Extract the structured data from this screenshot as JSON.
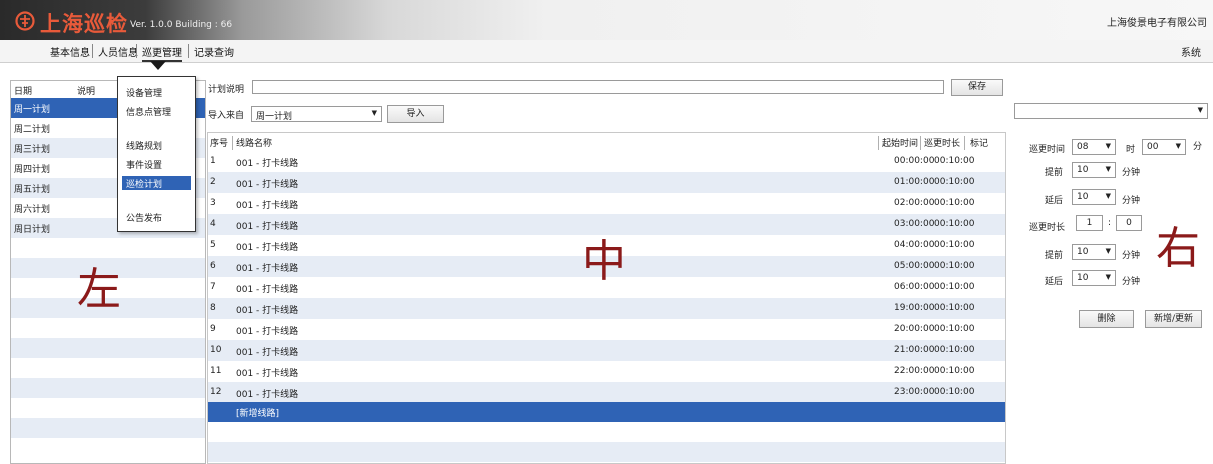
{
  "header": {
    "app_name": "上海巡检",
    "version": "Ver. 1.0.0 Building : 66",
    "company": "上海俊景电子有限公司"
  },
  "menu": {
    "items": [
      "基本信息",
      "人员信息",
      "巡更管理",
      "记录查询"
    ],
    "active_index": 2,
    "system": "系统"
  },
  "left": {
    "headers": [
      "日期",
      "说明"
    ],
    "rows": [
      "周一计划",
      "周二计划",
      "周三计划",
      "周四计划",
      "周五计划",
      "周六计划",
      "周日计划"
    ],
    "selected_index": 0,
    "watermark": "左"
  },
  "dropdown": {
    "items": [
      "设备管理",
      "信息点管理",
      "线路规划",
      "事件设置",
      "巡检计划",
      "公告发布"
    ],
    "selected_index": 4
  },
  "middle": {
    "plan_desc_label": "计划说明",
    "plan_desc_value": "",
    "save_label": "保存",
    "import_from_label": "导入来自",
    "import_from_value": "周一计划",
    "import_label": "导入",
    "columns": [
      "序号",
      "线路名称",
      "起始时间",
      "巡更时长",
      "标记"
    ],
    "rows": [
      {
        "no": "1",
        "name": "001 - 打卡线路",
        "start": "00:00:00",
        "duration": "00:10:00"
      },
      {
        "no": "2",
        "name": "001 - 打卡线路",
        "start": "01:00:00",
        "duration": "00:10:00"
      },
      {
        "no": "3",
        "name": "001 - 打卡线路",
        "start": "02:00:00",
        "duration": "00:10:00"
      },
      {
        "no": "4",
        "name": "001 - 打卡线路",
        "start": "03:00:00",
        "duration": "00:10:00"
      },
      {
        "no": "5",
        "name": "001 - 打卡线路",
        "start": "04:00:00",
        "duration": "00:10:00"
      },
      {
        "no": "6",
        "name": "001 - 打卡线路",
        "start": "05:00:00",
        "duration": "00:10:00"
      },
      {
        "no": "7",
        "name": "001 - 打卡线路",
        "start": "06:00:00",
        "duration": "00:10:00"
      },
      {
        "no": "8",
        "name": "001 - 打卡线路",
        "start": "19:00:00",
        "duration": "00:10:00"
      },
      {
        "no": "9",
        "name": "001 - 打卡线路",
        "start": "20:00:00",
        "duration": "00:10:00"
      },
      {
        "no": "10",
        "name": "001 - 打卡线路",
        "start": "21:00:00",
        "duration": "00:10:00"
      },
      {
        "no": "11",
        "name": "001 - 打卡线路",
        "start": "22:00:00",
        "duration": "00:10:00"
      },
      {
        "no": "12",
        "name": "001 - 打卡线路",
        "start": "23:00:00",
        "duration": "00:10:00"
      }
    ],
    "new_row_label": "[新增线路]",
    "watermark": "中"
  },
  "right": {
    "top_select_value": "",
    "patrol_time_label": "巡更时间",
    "hour_value": "08",
    "hour_unit": "时",
    "minute_value": "00",
    "minute_unit": "分",
    "early_label": "提前",
    "late_label": "延后",
    "early1_value": "10",
    "late1_value": "10",
    "minutes_unit": "分钟",
    "duration_label": "巡更时长",
    "duration_h": "1",
    "duration_sep": ":",
    "duration_m": "0",
    "early2_value": "10",
    "late2_value": "10",
    "delete_label": "删除",
    "update_label": "新增/更新",
    "watermark": "右"
  },
  "colors": {
    "selection": "#2f63b5",
    "alt_row": "#e6ecf5",
    "watermark": "#8b1a1a",
    "logo_red": "#e85a3a"
  }
}
